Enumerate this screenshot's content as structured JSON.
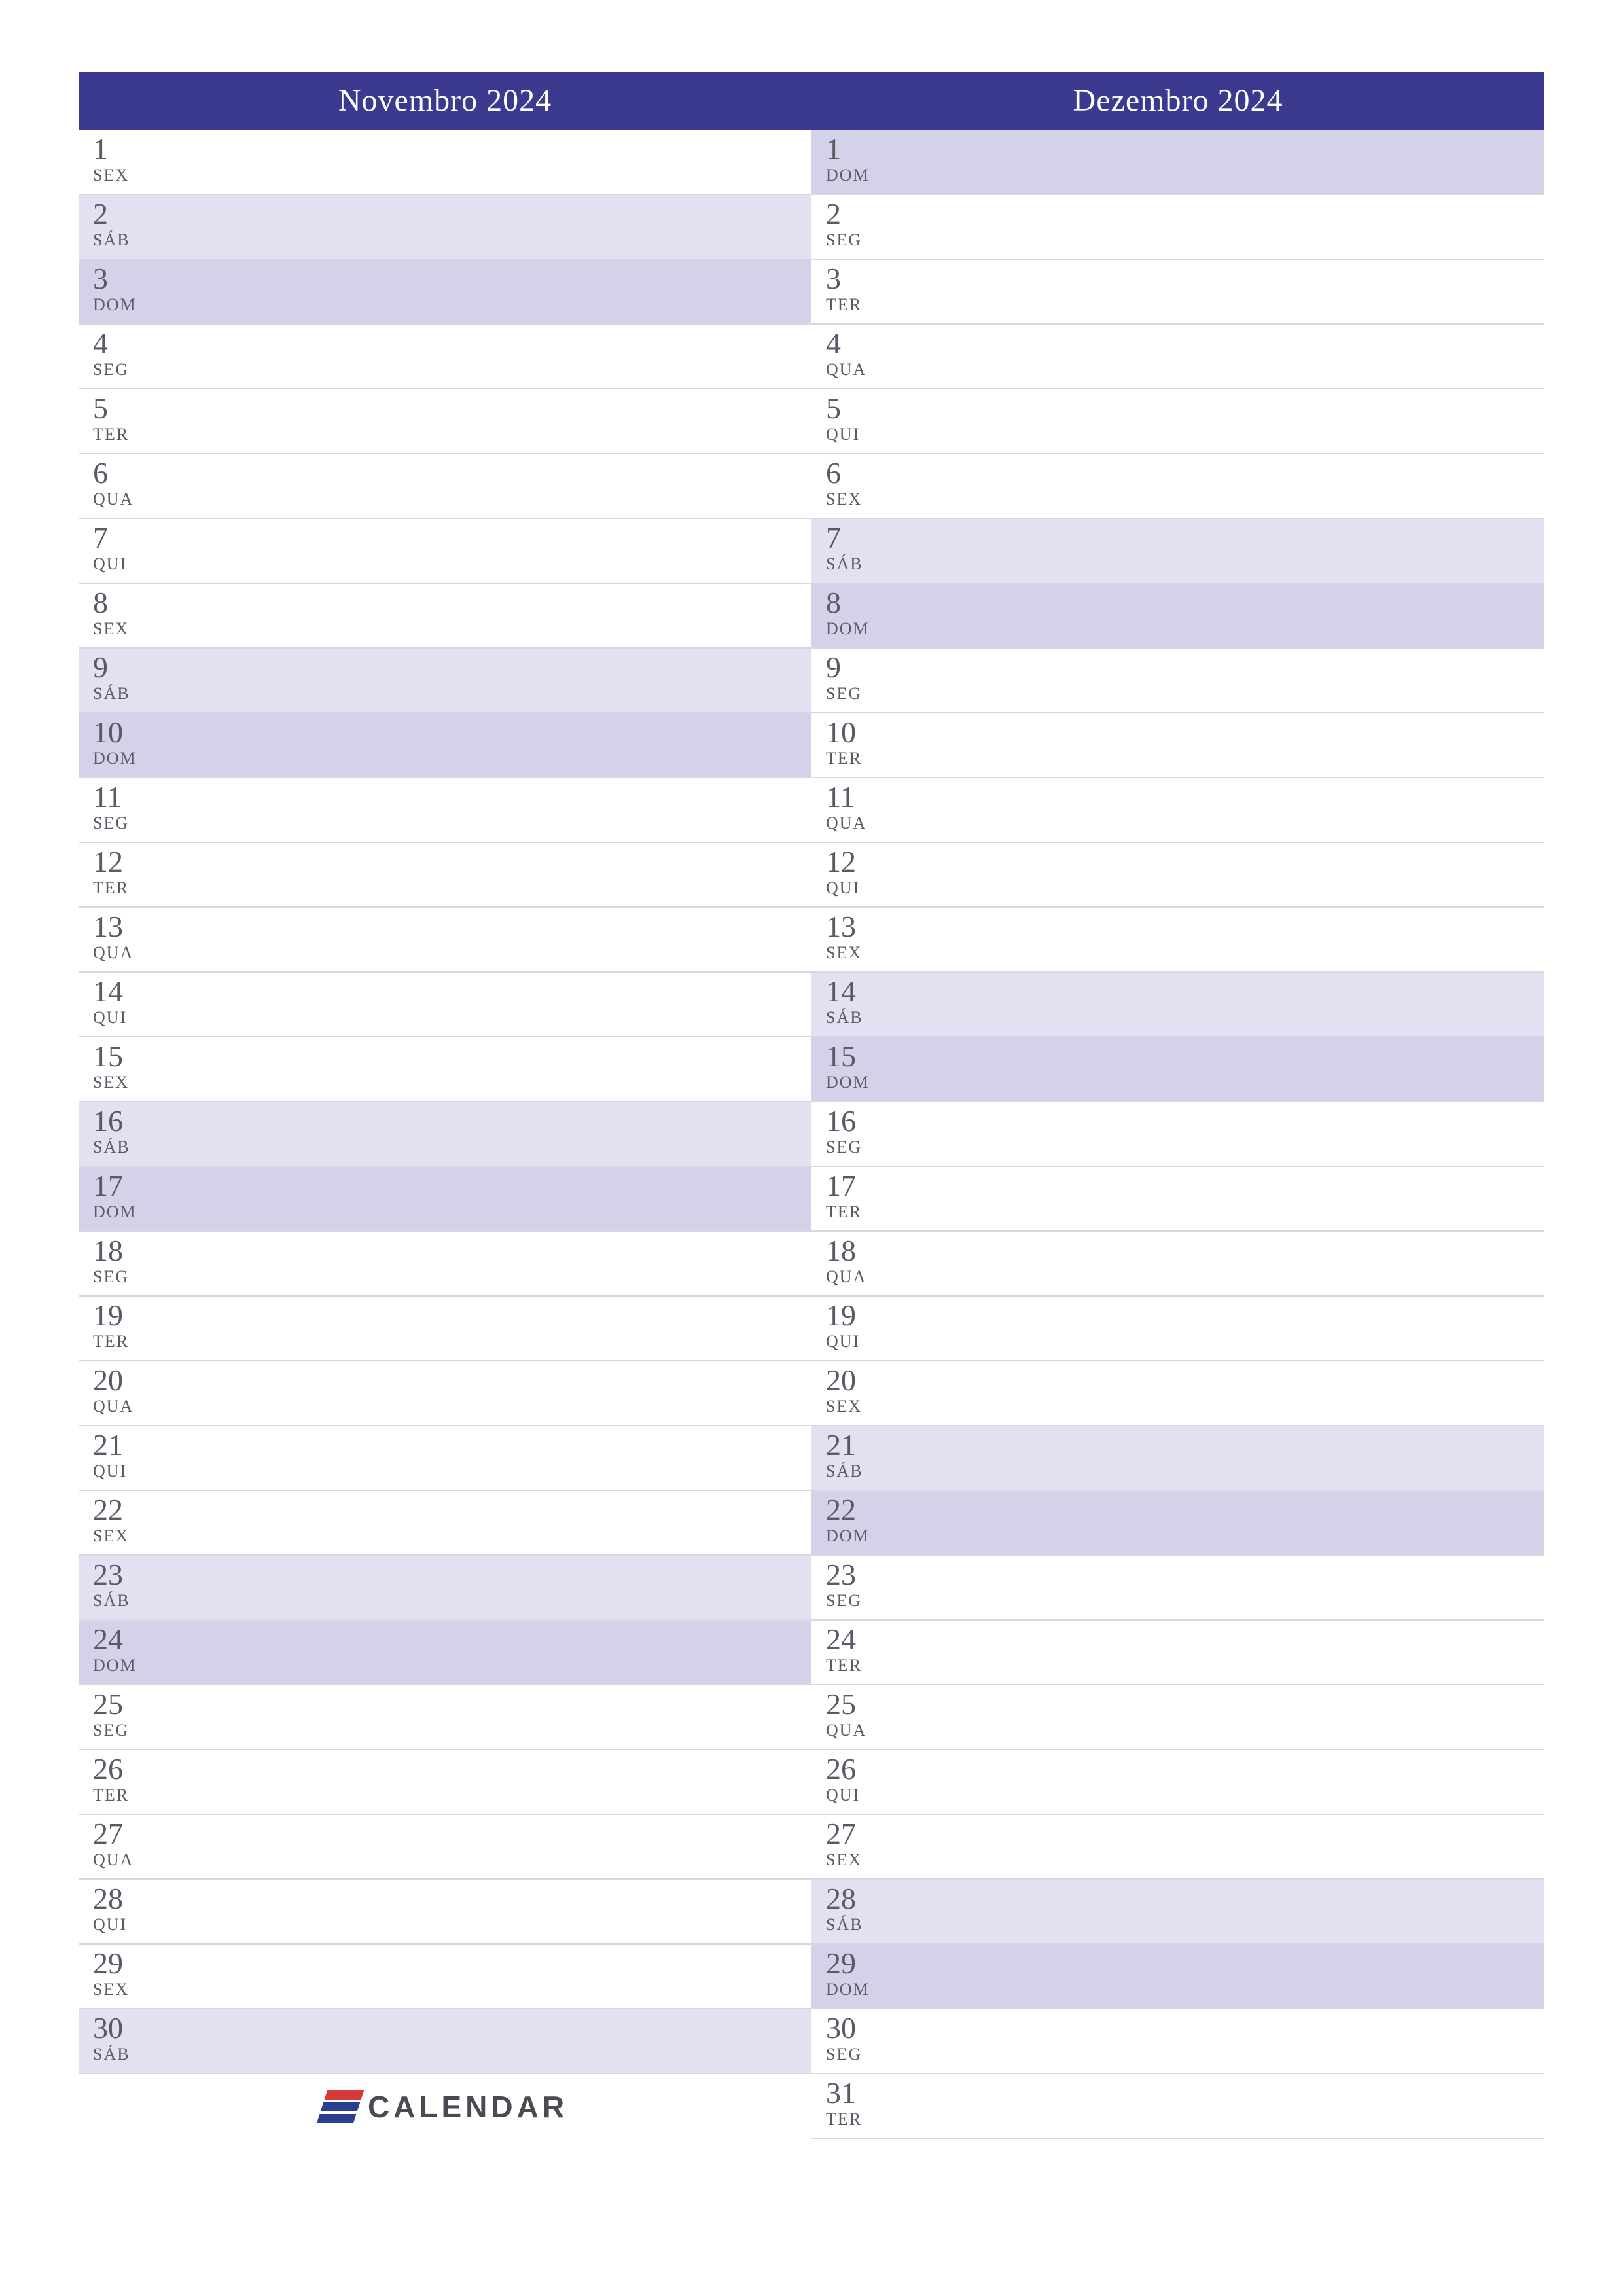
{
  "brand": {
    "name": "CALENDAR"
  },
  "months": [
    {
      "title": "Novembro 2024",
      "days": [
        {
          "n": "1",
          "dow": "SEX",
          "cls": ""
        },
        {
          "n": "2",
          "dow": "SÁB",
          "cls": "sat"
        },
        {
          "n": "3",
          "dow": "DOM",
          "cls": "sun"
        },
        {
          "n": "4",
          "dow": "SEG",
          "cls": ""
        },
        {
          "n": "5",
          "dow": "TER",
          "cls": ""
        },
        {
          "n": "6",
          "dow": "QUA",
          "cls": ""
        },
        {
          "n": "7",
          "dow": "QUI",
          "cls": ""
        },
        {
          "n": "8",
          "dow": "SEX",
          "cls": ""
        },
        {
          "n": "9",
          "dow": "SÁB",
          "cls": "sat"
        },
        {
          "n": "10",
          "dow": "DOM",
          "cls": "sun"
        },
        {
          "n": "11",
          "dow": "SEG",
          "cls": ""
        },
        {
          "n": "12",
          "dow": "TER",
          "cls": ""
        },
        {
          "n": "13",
          "dow": "QUA",
          "cls": ""
        },
        {
          "n": "14",
          "dow": "QUI",
          "cls": ""
        },
        {
          "n": "15",
          "dow": "SEX",
          "cls": ""
        },
        {
          "n": "16",
          "dow": "SÁB",
          "cls": "sat"
        },
        {
          "n": "17",
          "dow": "DOM",
          "cls": "sun"
        },
        {
          "n": "18",
          "dow": "SEG",
          "cls": ""
        },
        {
          "n": "19",
          "dow": "TER",
          "cls": ""
        },
        {
          "n": "20",
          "dow": "QUA",
          "cls": ""
        },
        {
          "n": "21",
          "dow": "QUI",
          "cls": ""
        },
        {
          "n": "22",
          "dow": "SEX",
          "cls": ""
        },
        {
          "n": "23",
          "dow": "SÁB",
          "cls": "sat"
        },
        {
          "n": "24",
          "dow": "DOM",
          "cls": "sun"
        },
        {
          "n": "25",
          "dow": "SEG",
          "cls": ""
        },
        {
          "n": "26",
          "dow": "TER",
          "cls": ""
        },
        {
          "n": "27",
          "dow": "QUA",
          "cls": ""
        },
        {
          "n": "28",
          "dow": "QUI",
          "cls": ""
        },
        {
          "n": "29",
          "dow": "SEX",
          "cls": ""
        },
        {
          "n": "30",
          "dow": "SÁB",
          "cls": "sat"
        }
      ]
    },
    {
      "title": "Dezembro 2024",
      "days": [
        {
          "n": "1",
          "dow": "DOM",
          "cls": "sun"
        },
        {
          "n": "2",
          "dow": "SEG",
          "cls": ""
        },
        {
          "n": "3",
          "dow": "TER",
          "cls": ""
        },
        {
          "n": "4",
          "dow": "QUA",
          "cls": ""
        },
        {
          "n": "5",
          "dow": "QUI",
          "cls": ""
        },
        {
          "n": "6",
          "dow": "SEX",
          "cls": ""
        },
        {
          "n": "7",
          "dow": "SÁB",
          "cls": "sat"
        },
        {
          "n": "8",
          "dow": "DOM",
          "cls": "sun"
        },
        {
          "n": "9",
          "dow": "SEG",
          "cls": ""
        },
        {
          "n": "10",
          "dow": "TER",
          "cls": ""
        },
        {
          "n": "11",
          "dow": "QUA",
          "cls": ""
        },
        {
          "n": "12",
          "dow": "QUI",
          "cls": ""
        },
        {
          "n": "13",
          "dow": "SEX",
          "cls": ""
        },
        {
          "n": "14",
          "dow": "SÁB",
          "cls": "sat"
        },
        {
          "n": "15",
          "dow": "DOM",
          "cls": "sun"
        },
        {
          "n": "16",
          "dow": "SEG",
          "cls": ""
        },
        {
          "n": "17",
          "dow": "TER",
          "cls": ""
        },
        {
          "n": "18",
          "dow": "QUA",
          "cls": ""
        },
        {
          "n": "19",
          "dow": "QUI",
          "cls": ""
        },
        {
          "n": "20",
          "dow": "SEX",
          "cls": ""
        },
        {
          "n": "21",
          "dow": "SÁB",
          "cls": "sat"
        },
        {
          "n": "22",
          "dow": "DOM",
          "cls": "sun"
        },
        {
          "n": "23",
          "dow": "SEG",
          "cls": ""
        },
        {
          "n": "24",
          "dow": "TER",
          "cls": ""
        },
        {
          "n": "25",
          "dow": "QUA",
          "cls": ""
        },
        {
          "n": "26",
          "dow": "QUI",
          "cls": ""
        },
        {
          "n": "27",
          "dow": "SEX",
          "cls": ""
        },
        {
          "n": "28",
          "dow": "SÁB",
          "cls": "sat"
        },
        {
          "n": "29",
          "dow": "DOM",
          "cls": "sun"
        },
        {
          "n": "30",
          "dow": "SEG",
          "cls": ""
        },
        {
          "n": "31",
          "dow": "TER",
          "cls": ""
        }
      ]
    }
  ]
}
